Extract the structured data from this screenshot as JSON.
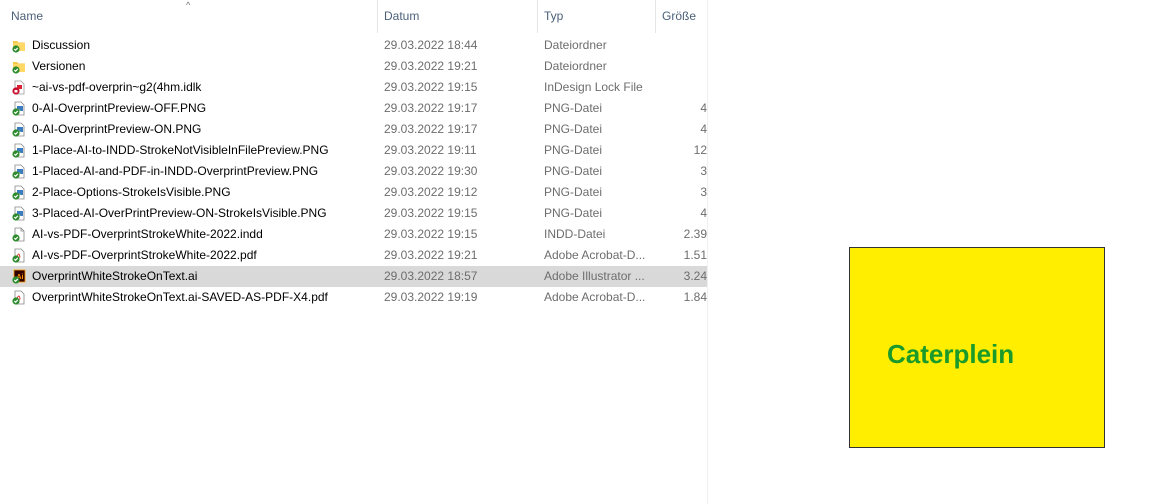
{
  "columns": {
    "name": "Name",
    "date": "Datum",
    "type": "Typ",
    "size": "Größe"
  },
  "sort_indicator": "^",
  "files": [
    {
      "name": "Discussion",
      "date": "29.03.2022 18:44",
      "type": "Dateiordner",
      "size": "",
      "icon": "folder-icon",
      "selected": false
    },
    {
      "name": "Versionen",
      "date": "29.03.2022 19:21",
      "type": "Dateiordner",
      "size": "",
      "icon": "folder-icon",
      "selected": false
    },
    {
      "name": "~ai-vs-pdf-overprin~g2(4hm.idlk",
      "date": "29.03.2022 19:15",
      "type": "InDesign Lock File",
      "size": "",
      "icon": "indesign-lock-icon",
      "selected": false
    },
    {
      "name": "0-AI-OverprintPreview-OFF.PNG",
      "date": "29.03.2022 19:17",
      "type": "PNG-Datei",
      "size": "4",
      "icon": "image-file-icon",
      "selected": false
    },
    {
      "name": "0-AI-OverprintPreview-ON.PNG",
      "date": "29.03.2022 19:17",
      "type": "PNG-Datei",
      "size": "4",
      "icon": "image-file-icon",
      "selected": false
    },
    {
      "name": "1-Place-AI-to-INDD-StrokeNotVisibleInFilePreview.PNG",
      "date": "29.03.2022 19:11",
      "type": "PNG-Datei",
      "size": "12",
      "icon": "image-file-icon",
      "selected": false
    },
    {
      "name": "1-Placed-AI-and-PDF-in-INDD-OverprintPreview.PNG",
      "date": "29.03.2022 19:30",
      "type": "PNG-Datei",
      "size": "3",
      "icon": "image-file-icon",
      "selected": false
    },
    {
      "name": "2-Place-Options-StrokeIsVisible.PNG",
      "date": "29.03.2022 19:12",
      "type": "PNG-Datei",
      "size": "3",
      "icon": "image-file-icon",
      "selected": false
    },
    {
      "name": "3-Placed-AI-OverPrintPreview-ON-StrokeIsVisible.PNG",
      "date": "29.03.2022 19:15",
      "type": "PNG-Datei",
      "size": "4",
      "icon": "image-file-icon",
      "selected": false
    },
    {
      "name": "AI-vs-PDF-OverprintStrokeWhite-2022.indd",
      "date": "29.03.2022 19:15",
      "type": "INDD-Datei",
      "size": "2.39",
      "icon": "indd-file-icon",
      "selected": false
    },
    {
      "name": "AI-vs-PDF-OverprintStrokeWhite-2022.pdf",
      "date": "29.03.2022 19:21",
      "type": "Adobe Acrobat-D...",
      "size": "1.51",
      "icon": "pdf-file-icon",
      "selected": false
    },
    {
      "name": "OverprintWhiteStrokeOnText.ai",
      "date": "29.03.2022 18:57",
      "type": "Adobe Illustrator ...",
      "size": "3.24",
      "icon": "illustrator-file-icon",
      "selected": true
    },
    {
      "name": "OverprintWhiteStrokeOnText.ai-SAVED-AS-PDF-X4.pdf",
      "date": "29.03.2022 19:19",
      "type": "Adobe Acrobat-D...",
      "size": "1.84",
      "icon": "pdf-file-icon",
      "selected": false
    }
  ],
  "artwork": {
    "text": "Caterplein",
    "background": "#ffee00",
    "text_color": "#1a9a2a"
  }
}
